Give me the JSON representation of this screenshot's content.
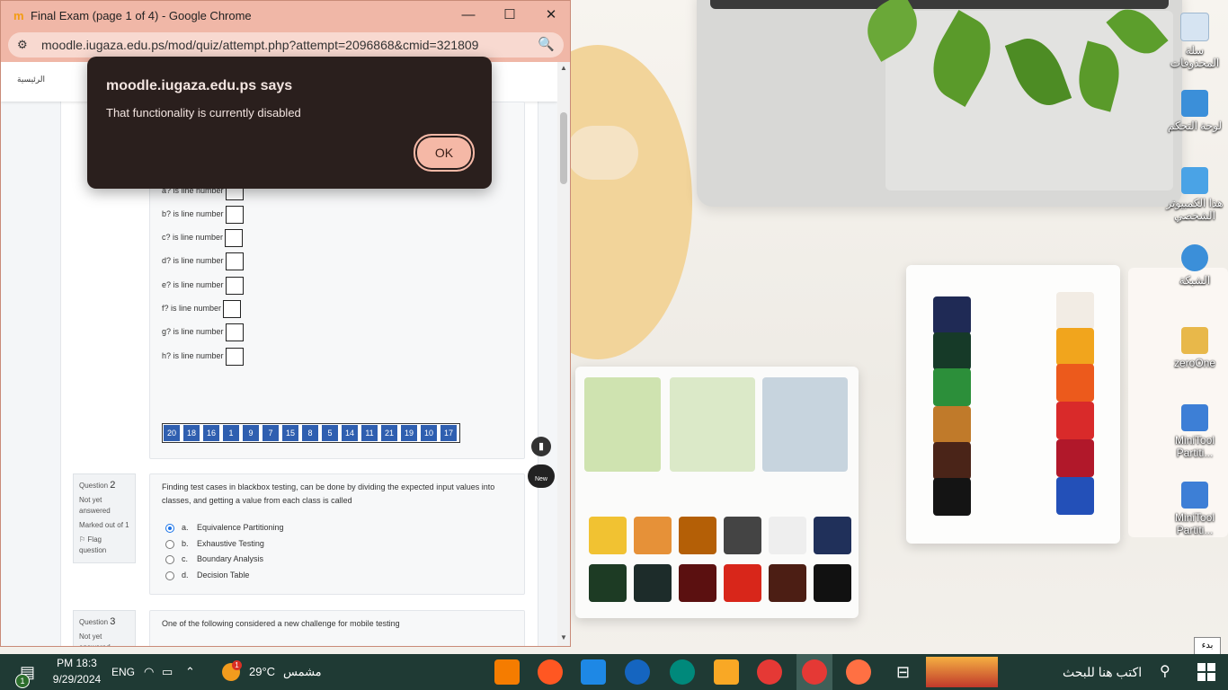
{
  "browser": {
    "window_title": "Final Exam (page 1 of 4) - Google Chrome",
    "favicon": "moodle-m",
    "url": "moodle.iugaza.edu.ps/mod/quiz/attempt.php?attempt=2096868&cmid=321809",
    "minimize_glyph": "—",
    "maximize_glyph": "☐",
    "close_glyph": "✕",
    "site_info_glyph": "⚙",
    "zoom_glyph": "🔍"
  },
  "page": {
    "home_label": "الرئيسية",
    "question1": {
      "lines": [
        {
          "label": "a? is line number"
        },
        {
          "label": "b? is line number"
        },
        {
          "label": "c? is line number"
        },
        {
          "label": "d? is line number"
        },
        {
          "label": "e? is line number"
        },
        {
          "label": "f? is line number"
        },
        {
          "label": "g? is line number"
        },
        {
          "label": "h? is line number"
        }
      ],
      "tiles": [
        "20",
        "18",
        "16",
        "1",
        "9",
        "7",
        "15",
        "8",
        "5",
        "14",
        "11",
        "21",
        "19",
        "10",
        "17"
      ]
    },
    "question2": {
      "label": "Question",
      "number": "2",
      "status": "Not yet answered",
      "marks": "Marked out of 1",
      "flag": "Flag question",
      "text": "Finding test cases in blackbox testing, can be done by dividing the expected input values into classes, and getting a value from each class is called",
      "options": [
        {
          "letter": "a.",
          "text": "Equivalence Partitioning",
          "selected": true
        },
        {
          "letter": "b.",
          "text": "Exhaustive Testing",
          "selected": false
        },
        {
          "letter": "c.",
          "text": "Boundary Analysis",
          "selected": false
        },
        {
          "letter": "d.",
          "text": "Decision Table",
          "selected": false
        }
      ]
    },
    "question3": {
      "label": "Question",
      "number": "3",
      "status": "Not yet answered",
      "text": "One of the following considered a new challenge for mobile testing"
    },
    "new_badge": "New"
  },
  "alert": {
    "title": "moodle.iugaza.edu.ps says",
    "message": "That functionality is currently disabled",
    "ok_label": "OK"
  },
  "desktop_icons": [
    {
      "label": "سلة المحذوفات",
      "icon": "recycle-bin-icon"
    },
    {
      "label": "لوحة التحكم",
      "icon": "control-panel-icon"
    },
    {
      "label": "هذا الكمبيوتر الشخصي",
      "icon": "this-pc-icon"
    },
    {
      "label": "الشبكة",
      "icon": "network-icon"
    },
    {
      "label": "zeroOne",
      "icon": "user-folder-icon"
    },
    {
      "label": "MiniTool Partiti...",
      "icon": "minitool-icon"
    },
    {
      "label": "MiniTool Partiti...",
      "icon": "minitool-icon"
    }
  ],
  "taskbar": {
    "start_tooltip": "بدء",
    "search_placeholder": "اكتب هنا للبحث",
    "weather_temp": "29°C",
    "weather_text": "مشمس",
    "language": "ENG",
    "time": "PM 18:3",
    "date": "9/29/2024",
    "notification_count": "1",
    "weather_badge": "1",
    "colors": {
      "taskbar_bg": "#1f3a34",
      "titlebar": "#f0b7a7"
    }
  }
}
